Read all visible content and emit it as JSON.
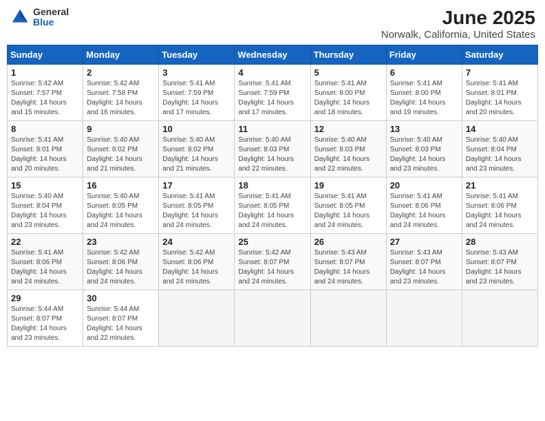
{
  "header": {
    "logo_general": "General",
    "logo_blue": "Blue",
    "title": "June 2025",
    "subtitle": "Norwalk, California, United States"
  },
  "weekdays": [
    "Sunday",
    "Monday",
    "Tuesday",
    "Wednesday",
    "Thursday",
    "Friday",
    "Saturday"
  ],
  "weeks": [
    [
      {
        "day": "1",
        "sunrise": "5:42 AM",
        "sunset": "7:57 PM",
        "daylight": "14 hours and 15 minutes."
      },
      {
        "day": "2",
        "sunrise": "5:42 AM",
        "sunset": "7:58 PM",
        "daylight": "14 hours and 16 minutes."
      },
      {
        "day": "3",
        "sunrise": "5:41 AM",
        "sunset": "7:59 PM",
        "daylight": "14 hours and 17 minutes."
      },
      {
        "day": "4",
        "sunrise": "5:41 AM",
        "sunset": "7:59 PM",
        "daylight": "14 hours and 17 minutes."
      },
      {
        "day": "5",
        "sunrise": "5:41 AM",
        "sunset": "8:00 PM",
        "daylight": "14 hours and 18 minutes."
      },
      {
        "day": "6",
        "sunrise": "5:41 AM",
        "sunset": "8:00 PM",
        "daylight": "14 hours and 19 minutes."
      },
      {
        "day": "7",
        "sunrise": "5:41 AM",
        "sunset": "8:01 PM",
        "daylight": "14 hours and 20 minutes."
      }
    ],
    [
      {
        "day": "8",
        "sunrise": "5:41 AM",
        "sunset": "8:01 PM",
        "daylight": "14 hours and 20 minutes."
      },
      {
        "day": "9",
        "sunrise": "5:40 AM",
        "sunset": "8:02 PM",
        "daylight": "14 hours and 21 minutes."
      },
      {
        "day": "10",
        "sunrise": "5:40 AM",
        "sunset": "8:02 PM",
        "daylight": "14 hours and 21 minutes."
      },
      {
        "day": "11",
        "sunrise": "5:40 AM",
        "sunset": "8:03 PM",
        "daylight": "14 hours and 22 minutes."
      },
      {
        "day": "12",
        "sunrise": "5:40 AM",
        "sunset": "8:03 PM",
        "daylight": "14 hours and 22 minutes."
      },
      {
        "day": "13",
        "sunrise": "5:40 AM",
        "sunset": "8:03 PM",
        "daylight": "14 hours and 23 minutes."
      },
      {
        "day": "14",
        "sunrise": "5:40 AM",
        "sunset": "8:04 PM",
        "daylight": "14 hours and 23 minutes."
      }
    ],
    [
      {
        "day": "15",
        "sunrise": "5:40 AM",
        "sunset": "8:04 PM",
        "daylight": "14 hours and 23 minutes."
      },
      {
        "day": "16",
        "sunrise": "5:40 AM",
        "sunset": "8:05 PM",
        "daylight": "14 hours and 24 minutes."
      },
      {
        "day": "17",
        "sunrise": "5:41 AM",
        "sunset": "8:05 PM",
        "daylight": "14 hours and 24 minutes."
      },
      {
        "day": "18",
        "sunrise": "5:41 AM",
        "sunset": "8:05 PM",
        "daylight": "14 hours and 24 minutes."
      },
      {
        "day": "19",
        "sunrise": "5:41 AM",
        "sunset": "8:05 PM",
        "daylight": "14 hours and 24 minutes."
      },
      {
        "day": "20",
        "sunrise": "5:41 AM",
        "sunset": "8:06 PM",
        "daylight": "14 hours and 24 minutes."
      },
      {
        "day": "21",
        "sunrise": "5:41 AM",
        "sunset": "8:06 PM",
        "daylight": "14 hours and 24 minutes."
      }
    ],
    [
      {
        "day": "22",
        "sunrise": "5:41 AM",
        "sunset": "8:06 PM",
        "daylight": "14 hours and 24 minutes."
      },
      {
        "day": "23",
        "sunrise": "5:42 AM",
        "sunset": "8:06 PM",
        "daylight": "14 hours and 24 minutes."
      },
      {
        "day": "24",
        "sunrise": "5:42 AM",
        "sunset": "8:06 PM",
        "daylight": "14 hours and 24 minutes."
      },
      {
        "day": "25",
        "sunrise": "5:42 AM",
        "sunset": "8:07 PM",
        "daylight": "14 hours and 24 minutes."
      },
      {
        "day": "26",
        "sunrise": "5:43 AM",
        "sunset": "8:07 PM",
        "daylight": "14 hours and 24 minutes."
      },
      {
        "day": "27",
        "sunrise": "5:43 AM",
        "sunset": "8:07 PM",
        "daylight": "14 hours and 23 minutes."
      },
      {
        "day": "28",
        "sunrise": "5:43 AM",
        "sunset": "8:07 PM",
        "daylight": "14 hours and 23 minutes."
      }
    ],
    [
      {
        "day": "29",
        "sunrise": "5:44 AM",
        "sunset": "8:07 PM",
        "daylight": "14 hours and 23 minutes."
      },
      {
        "day": "30",
        "sunrise": "5:44 AM",
        "sunset": "8:07 PM",
        "daylight": "14 hours and 22 minutes."
      },
      null,
      null,
      null,
      null,
      null
    ]
  ]
}
